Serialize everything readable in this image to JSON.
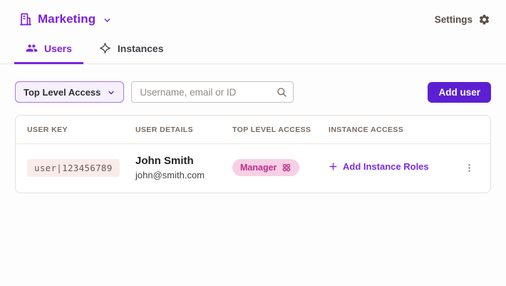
{
  "header": {
    "org_name": "Marketing",
    "settings_label": "Settings"
  },
  "tabs": [
    {
      "label": "Users",
      "active": true,
      "icon": "users-group-icon"
    },
    {
      "label": "Instances",
      "active": false,
      "icon": "sparkle-icon"
    }
  ],
  "toolbar": {
    "filter_label": "Top Level Access",
    "search_placeholder": "Username, email or ID",
    "add_user_label": "Add user"
  },
  "table": {
    "columns": [
      "USER KEY",
      "USER DETAILS",
      "TOP LEVEL ACCESS",
      "INSTANCE ACCESS"
    ],
    "rows": [
      {
        "user_key": "user|123456789",
        "name": "John Smith",
        "email": "john@smith.com",
        "top_level_access": "Manager",
        "instance_access_action": "Add Instance Roles"
      }
    ]
  },
  "icons": {
    "brand": "building-icon",
    "org_dropdown": "chevron-down-icon",
    "settings": "gear-icon",
    "search": "search-icon",
    "role_badge": "roles-grid-icon",
    "add_roles": "plus-icon",
    "row_menu": "kebab-menu-icon"
  },
  "colors": {
    "brand_purple": "#7d1fe0",
    "tab_active_purple": "#7d24e2",
    "button_purple": "#5c20d2",
    "filter_bg": "#f6f0fd",
    "filter_border": "#a877e6",
    "role_badge_bg": "#f7d0e5",
    "role_badge_text": "#bd2d88",
    "user_key_bg": "#f9edea",
    "user_key_text": "#6e5a50",
    "muted_header_text": "#7b6a61",
    "settings_text": "#5b4c44"
  }
}
